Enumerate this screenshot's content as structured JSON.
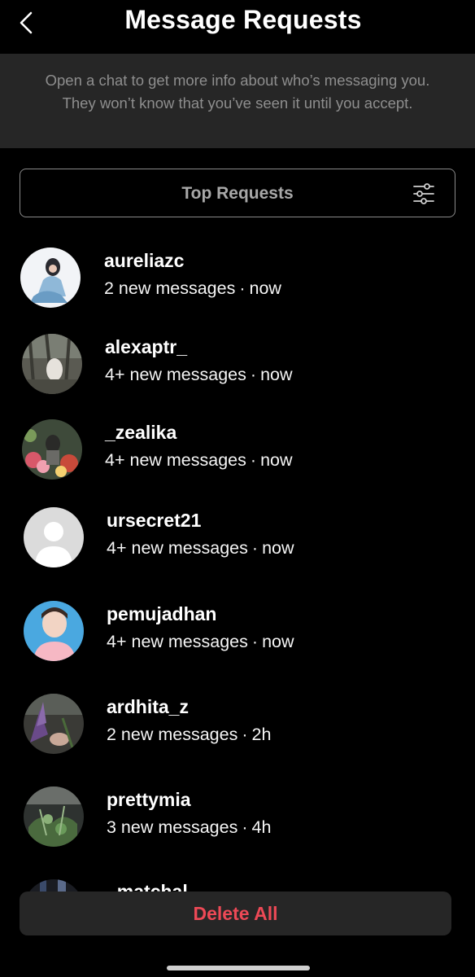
{
  "header": {
    "title": "Message Requests",
    "back_icon": "chevron-left-icon"
  },
  "info_banner": {
    "text": "Open a chat to get more info about who’s messaging you. They won’t know that you’ve seen it until you accept."
  },
  "filter": {
    "label": "Top Requests",
    "icon": "sliders-icon"
  },
  "requests": [
    {
      "username": "aureliazc",
      "messages": "2 new messages",
      "time": "now",
      "avatar": "photo-person-sitting"
    },
    {
      "username": "alexaptr_",
      "messages": "4+ new messages",
      "time": "now",
      "avatar": "photo-trees"
    },
    {
      "username": "_zealika",
      "messages": "4+ new messages",
      "time": "now",
      "avatar": "photo-flower-market"
    },
    {
      "username": "ursecret21",
      "messages": "4+ new messages",
      "time": "now",
      "avatar": "default-avatar"
    },
    {
      "username": "pemujadhan",
      "messages": "4+ new messages",
      "time": "now",
      "avatar": "photo-portrait"
    },
    {
      "username": "ardhita_z",
      "messages": "2 new messages",
      "time": "2h",
      "avatar": "photo-flowers-dark"
    },
    {
      "username": "prettymia",
      "messages": "3 new messages",
      "time": "4h",
      "avatar": "photo-plants"
    },
    {
      "username": "_matchal",
      "messages": "",
      "time": "",
      "avatar": "photo-partial"
    }
  ],
  "separator": "·",
  "footer": {
    "delete_all_label": "Delete All"
  },
  "colors": {
    "background": "#000000",
    "banner": "#262626",
    "secondary_text": "#8e8e8e",
    "danger": "#ed4956"
  }
}
